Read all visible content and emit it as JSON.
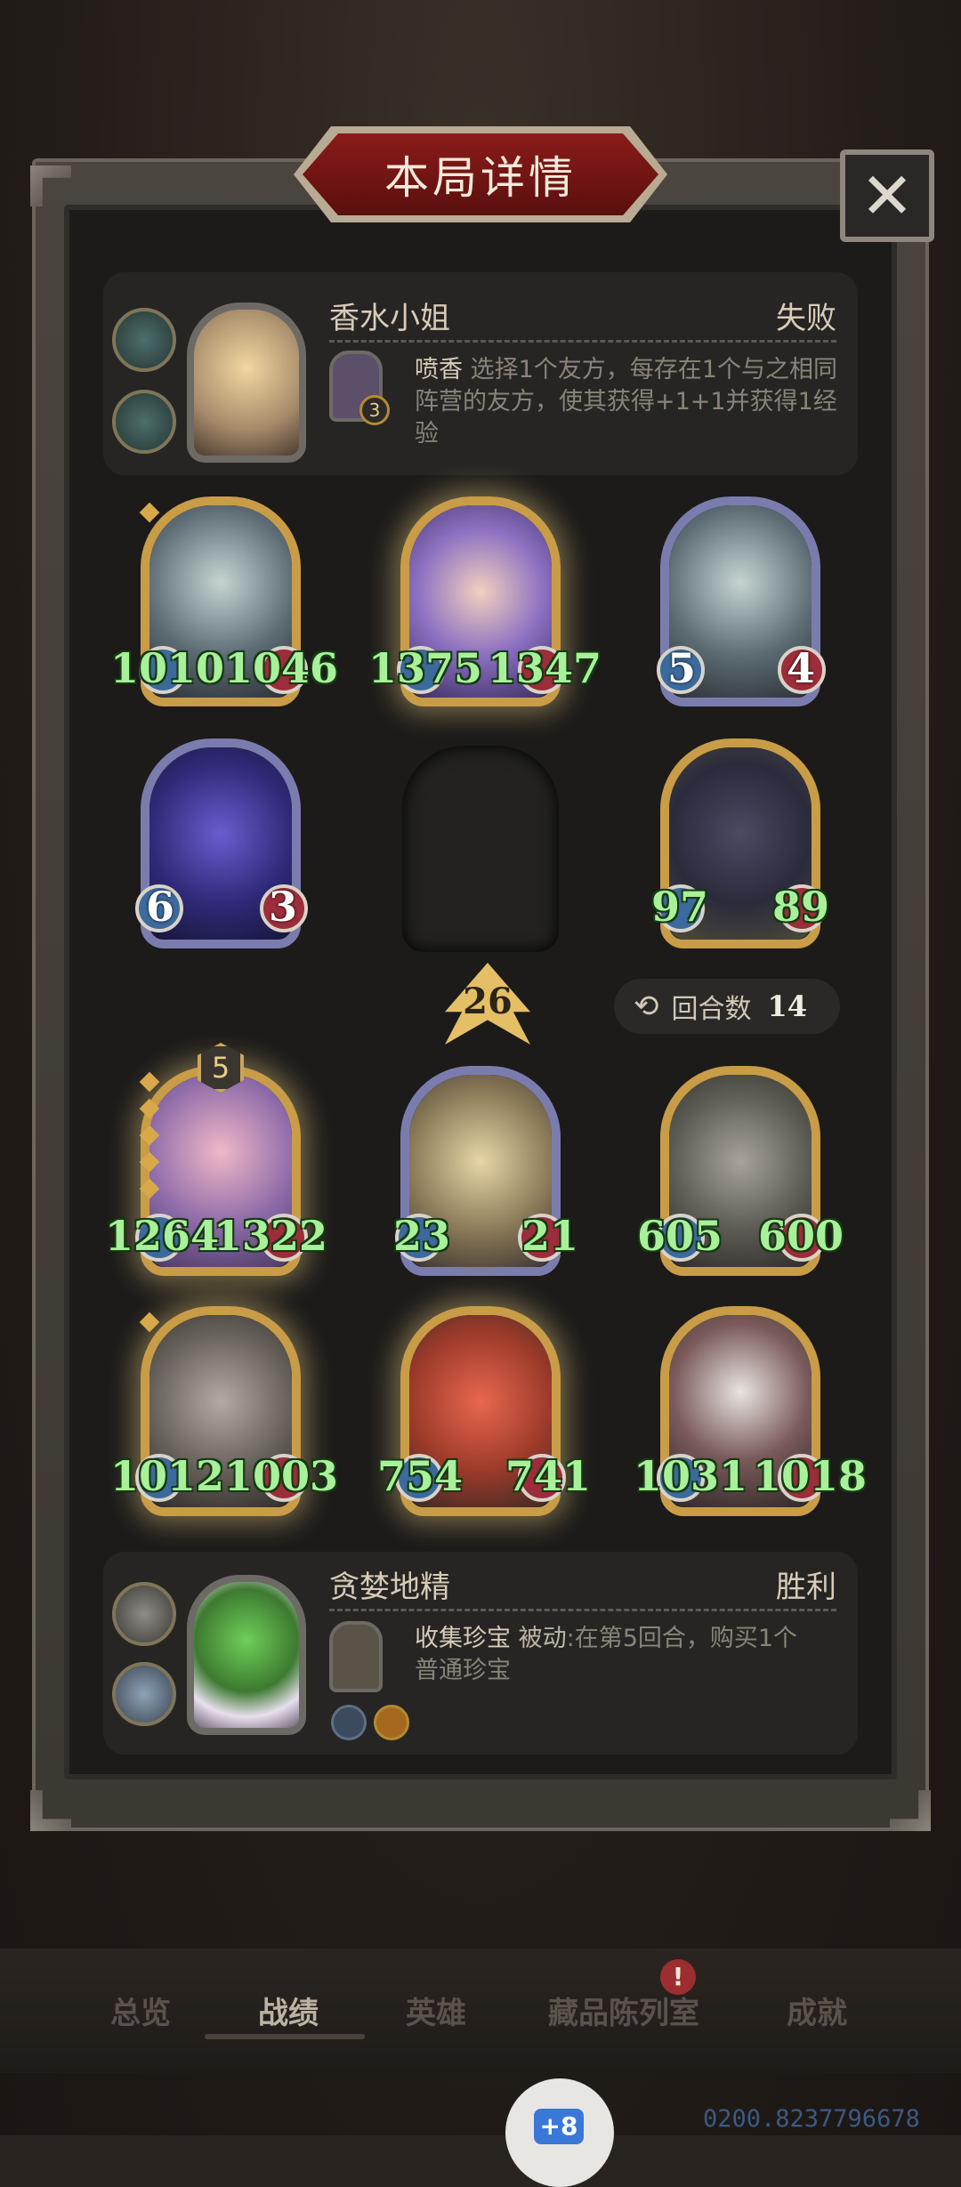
{
  "header": {
    "title": "本局详情"
  },
  "opponent": {
    "name": "香水小姐",
    "result": "失败",
    "ability_name": "喷香",
    "ability_text_line1": " 选择1个友方，每存在1个与之相同",
    "ability_text_line2": "阵营的友方，使其获得+1+1并获得1经验",
    "mini_level": "3"
  },
  "units": [
    {
      "atk": "1010",
      "hp": "1046"
    },
    {
      "atk": "1375",
      "hp": "1347"
    },
    {
      "atk": "5",
      "hp": "4"
    },
    {
      "atk": "6",
      "hp": "3"
    },
    {
      "atk": "97",
      "hp": "89"
    },
    {
      "atk": "1264",
      "hp": "1322"
    },
    {
      "atk": "23",
      "hp": "21"
    },
    {
      "atk": "605",
      "hp": "600"
    },
    {
      "atk": "1012",
      "hp": "1003"
    },
    {
      "atk": "754",
      "hp": "741"
    },
    {
      "atk": "1031",
      "hp": "1018"
    }
  ],
  "level_up": {
    "value": "26"
  },
  "round_info": {
    "label": "回合数",
    "value": "14"
  },
  "unit_level_badge": "5",
  "player": {
    "name": "贪婪地精",
    "result": "胜利",
    "ability_name": "收集珍宝",
    "ability_tag": " 被动",
    "ability_text_line1": ":在第5回合，购买1个",
    "ability_text_line2": "普通珍宝"
  },
  "tabs": [
    {
      "label": "总览",
      "active": false
    },
    {
      "label": "战绩",
      "active": true
    },
    {
      "label": "英雄",
      "active": false
    },
    {
      "label": "藏品陈列室",
      "active": false
    },
    {
      "label": "成就",
      "active": false
    }
  ],
  "notification_badge": "!",
  "fab": {
    "label": "+8"
  },
  "footer_code": "0200.8237796678"
}
